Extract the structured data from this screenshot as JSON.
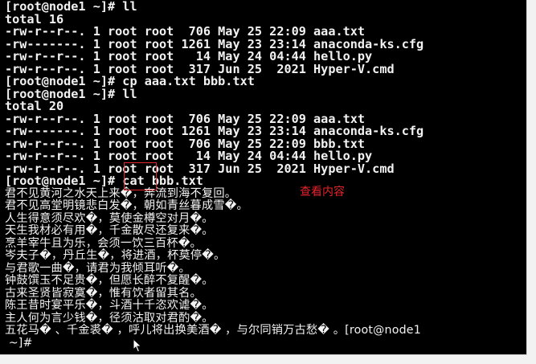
{
  "window": {
    "background": "#000000",
    "text_color": "#f2f2f2",
    "accent": "#e0262c"
  },
  "terminal": {
    "lines": [
      "[root@node1 ~]# ll",
      "total 16",
      "-rw-r--r--. 1 root root  706 May 25 22:09 aaa.txt",
      "-rw-------. 1 root root 1261 May 23 23:14 anaconda-ks.cfg",
      "-rw-r--r--. 1 root root   14 May 24 04:44 hello.py",
      "-rw-r--r--. 1 root root  317 Jun 25  2021 Hyper-V.cmd",
      "[root@node1 ~]# cp aaa.txt bbb.txt",
      "[root@node1 ~]# ll",
      "total 20",
      "-rw-r--r--. 1 root root  706 May 25 22:09 aaa.txt",
      "-rw-------. 1 root root 1261 May 23 23:14 anaconda-ks.cfg",
      "-rw-r--r--. 1 root root  706 May 25 22:09 bbb.txt",
      "-rw-r--r--. 1 root root   14 May 24 04:44 hello.py",
      "-rw-r--r--. 1 root root  317 Jun 25  2021 Hyper-V.cmd",
      "[root@node1 ~]# cat bbb.txt"
    ],
    "poem_lines": [
      "君不见黄河之水天上来�，奔流到海不复回。",
      "君不见高堂明镜悲白发�，朝如青丝暮成雪�。",
      "人生得意须尽欢�，莫使金樽空对月�。",
      "天生我材必有用�，千金散尽还复来�。",
      "烹羊宰牛且为乐，会须一饮三百杯�。",
      "岑夫子�，丹丘生�，将进酒，杯莫停�。",
      "与君歌一曲�，请君为我倾耳听�。",
      "钟鼓馔玉不足贵�，但愿长醉不复醒�。",
      "古来圣贤皆寂寞�，惟有饮者留其名。",
      "陈王昔时宴平乐�，斗酒十千恣欢谑�。",
      "主人何为言少钱�，径须沽取对君酌�。",
      "五花马� 、千金裘� ，呼儿将出换美酒� ，与尔同销万古愁� 。[root@node1",
      " ~]# "
    ]
  },
  "annotation": {
    "label": "查看内容"
  }
}
